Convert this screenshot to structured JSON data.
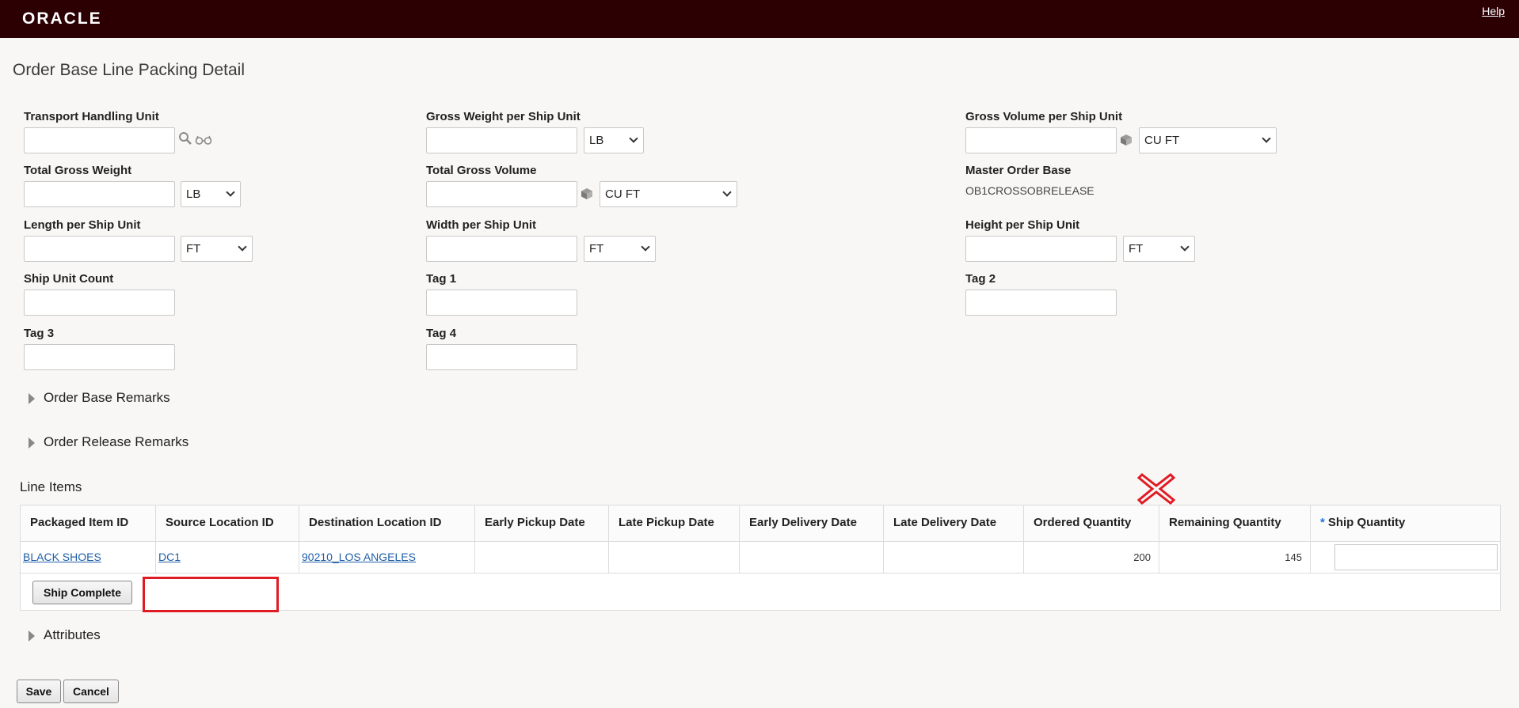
{
  "header": {
    "logo_text": "ORACLE",
    "help_label": "Help"
  },
  "page": {
    "title": "Order Base Line Packing Detail"
  },
  "form": {
    "transport_handling_unit": {
      "label": "Transport Handling Unit",
      "value": ""
    },
    "gross_weight_per_ship_unit": {
      "label": "Gross Weight per Ship Unit",
      "value": "",
      "unit": "LB"
    },
    "gross_volume_per_ship_unit": {
      "label": "Gross Volume per Ship Unit",
      "value": "",
      "unit": "CU FT"
    },
    "total_gross_weight": {
      "label": "Total Gross Weight",
      "value": "",
      "unit": "LB"
    },
    "total_gross_volume": {
      "label": "Total Gross Volume",
      "value": "",
      "unit": "CU FT"
    },
    "master_order_base": {
      "label": "Master Order Base",
      "value": "OB1CROSSOBRELEASE"
    },
    "length_per_ship_unit": {
      "label": "Length per Ship Unit",
      "value": "",
      "unit": "FT"
    },
    "width_per_ship_unit": {
      "label": "Width per Ship Unit",
      "value": "",
      "unit": "FT"
    },
    "height_per_ship_unit": {
      "label": "Height per Ship Unit",
      "value": "",
      "unit": "FT"
    },
    "ship_unit_count": {
      "label": "Ship Unit Count",
      "value": ""
    },
    "tag1": {
      "label": "Tag 1",
      "value": ""
    },
    "tag2": {
      "label": "Tag 2",
      "value": ""
    },
    "tag3": {
      "label": "Tag 3",
      "value": ""
    },
    "tag4": {
      "label": "Tag 4",
      "value": ""
    }
  },
  "sections": {
    "order_base_remarks": "Order Base Remarks",
    "order_release_remarks": "Order Release Remarks",
    "attributes": "Attributes"
  },
  "line_items": {
    "title": "Line Items",
    "columns": [
      "Packaged Item ID",
      "Source Location ID",
      "Destination Location ID",
      "Early Pickup Date",
      "Late Pickup Date",
      "Early Delivery Date",
      "Late Delivery Date",
      "Ordered Quantity",
      "Remaining Quantity",
      "Ship Quantity"
    ],
    "required_marker": "*",
    "rows": [
      {
        "packaged_item_id": "BLACK SHOES",
        "source_location_id": "DC1",
        "destination_location_id": "90210_LOS ANGELES",
        "early_pickup_date": "",
        "late_pickup_date": "",
        "early_delivery_date": "",
        "late_delivery_date": "",
        "ordered_quantity": "200",
        "remaining_quantity": "145",
        "ship_quantity": ""
      }
    ],
    "ship_complete_label": "Ship Complete"
  },
  "footer": {
    "save_label": "Save",
    "cancel_label": "Cancel"
  },
  "colors": {
    "header_bg": "#2c0003",
    "link": "#1f5fa8",
    "annotation_red": "#e01b24",
    "required_blue": "#1e73e8"
  }
}
